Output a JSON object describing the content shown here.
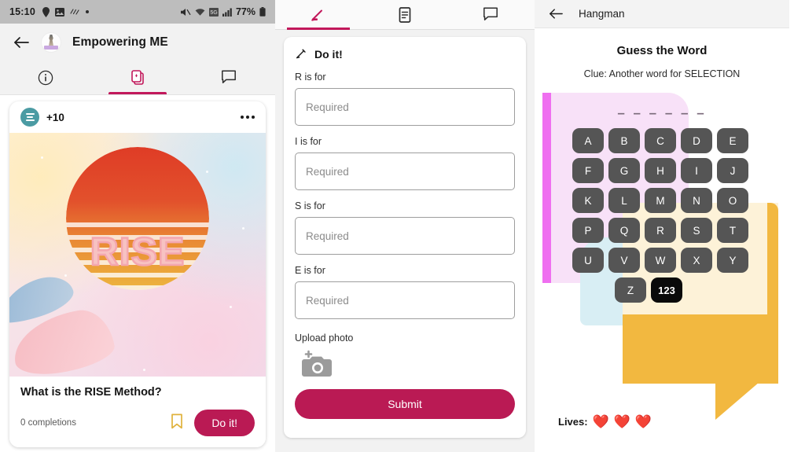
{
  "left_panel": {
    "statusbar": {
      "time": "15:10",
      "battery": "77%",
      "icons": [
        "location-pin-icon",
        "photo-icon",
        "vibrate-icon",
        "dot-icon"
      ],
      "right_icons": [
        "mute-icon",
        "wifi-icon",
        "network-icon",
        "signal-icon",
        "battery-icon"
      ]
    },
    "appbar": {
      "back_icon": "back-arrow-icon",
      "avatar": "app-logo-avatar",
      "title": "Empowering ME"
    },
    "tabs": [
      {
        "name": "info",
        "icon": "info-circle-icon",
        "active": false
      },
      {
        "name": "cards",
        "icon": "card-stack-icon",
        "active": true
      },
      {
        "name": "chat",
        "icon": "chat-bubble-icon",
        "active": false
      }
    ],
    "card": {
      "points_badge": "+10",
      "points_icon": "list-lines-icon",
      "more_icon": "more-options-icon",
      "image_word": "RISE",
      "title": "What is the RISE Method?",
      "completions": "0 completions",
      "bookmark_icon": "bookmark-icon",
      "action_label": "Do it!"
    }
  },
  "middle_panel": {
    "tabs": [
      {
        "name": "edit",
        "icon": "pencil-icon",
        "active": true
      },
      {
        "name": "document",
        "icon": "document-icon",
        "active": false
      },
      {
        "name": "chat",
        "icon": "chat-bubble-icon",
        "active": false
      }
    ],
    "form": {
      "header_icon": "pencil-icon",
      "header": "Do it!",
      "fields": [
        {
          "label": "R is for",
          "value": "",
          "placeholder": "Required"
        },
        {
          "label": "I is for",
          "value": "",
          "placeholder": "Required"
        },
        {
          "label": "S is for",
          "value": "",
          "placeholder": "Required"
        },
        {
          "label": "E is for",
          "value": "",
          "placeholder": "Required"
        }
      ],
      "upload_label": "Upload photo",
      "upload_icon": "add-photo-camera-icon",
      "submit_label": "Submit"
    }
  },
  "right_panel": {
    "appbar": {
      "back_icon": "back-arrow-icon",
      "title": "Hangman"
    },
    "heading": "Guess the Word",
    "clue": "Clue: Another word for SELECTION",
    "word_dashes": "– – – – – –",
    "word_length": 6,
    "keyboard": {
      "rows": [
        [
          "A",
          "B",
          "C",
          "D",
          "E"
        ],
        [
          "F",
          "G",
          "H",
          "I",
          "J"
        ],
        [
          "K",
          "L",
          "M",
          "N",
          "O"
        ],
        [
          "P",
          "Q",
          "R",
          "S",
          "T"
        ],
        [
          "U",
          "V",
          "W",
          "X",
          "Y"
        ]
      ],
      "last_row": [
        "Z"
      ],
      "numeric_key": "123"
    },
    "lives": {
      "label": "Lives:",
      "count": 3,
      "heart": "❤️"
    }
  },
  "colors": {
    "accent_pink": "#ba1a54",
    "tab_active": "#c2185b",
    "teal_badge": "#4b9ba3",
    "bookmark_gold": "#e0b23c",
    "key_gray": "#555555",
    "key_black": "#0a0a0a",
    "deco_magenta": "#ef6ff0",
    "deco_pink": "#f8e1f8",
    "deco_blue": "#d8eef4",
    "deco_orange": "#f2b840",
    "deco_cream": "#fdf2d8"
  }
}
